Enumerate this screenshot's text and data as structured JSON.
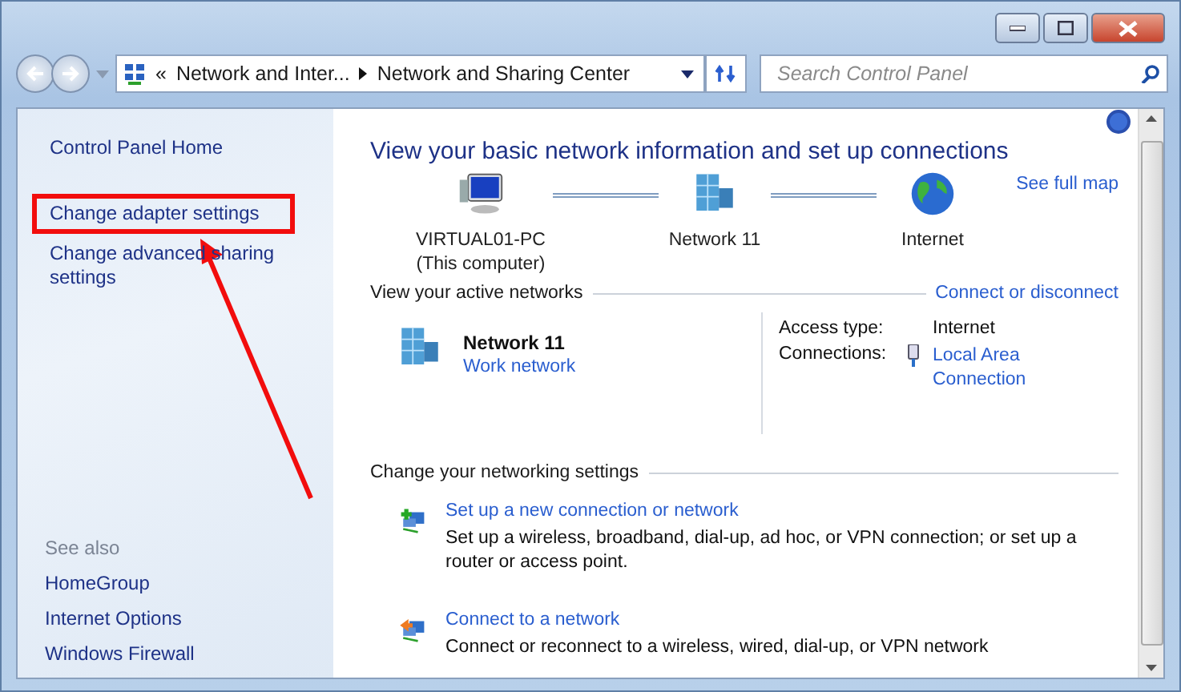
{
  "address_bar": {
    "overflow_mark": "«",
    "breadcrumbs": [
      "Network and Inter...",
      "Network and Sharing Center"
    ]
  },
  "search": {
    "placeholder": "Search Control Panel"
  },
  "sidebar": {
    "items": [
      {
        "label": "Control Panel Home",
        "annotated": false
      },
      {
        "label": "Change adapter settings",
        "annotated": true
      },
      {
        "label": "Change advanced sharing settings",
        "annotated": false
      }
    ],
    "see_also_title": "See also",
    "see_also": [
      "HomeGroup",
      "Internet Options",
      "Windows Firewall"
    ]
  },
  "main": {
    "title": "View your basic network information and set up connections",
    "see_full_map": "See full map",
    "map_nodes": [
      {
        "kind": "computer",
        "label": "VIRTUAL01-PC",
        "sublabel": "(This computer)"
      },
      {
        "kind": "network",
        "label": "Network  11"
      },
      {
        "kind": "internet",
        "label": "Internet"
      }
    ],
    "active_networks": {
      "heading": "View your active networks",
      "link": "Connect or disconnect",
      "name": "Network  11",
      "type": "Work network",
      "access_type_label": "Access type:",
      "access_type": "Internet",
      "connections_label": "Connections:",
      "connection": "Local Area Connection"
    },
    "settings_heading": "Change your networking settings",
    "tasks": [
      {
        "kind": "new",
        "title": "Set up a new connection or network",
        "description": "Set up a wireless, broadband, dial-up, ad hoc, or VPN connection; or set up a router or access point."
      },
      {
        "kind": "connect",
        "title": "Connect to a network",
        "description": "Connect or reconnect to a wireless, wired, dial-up, or VPN network"
      }
    ]
  }
}
